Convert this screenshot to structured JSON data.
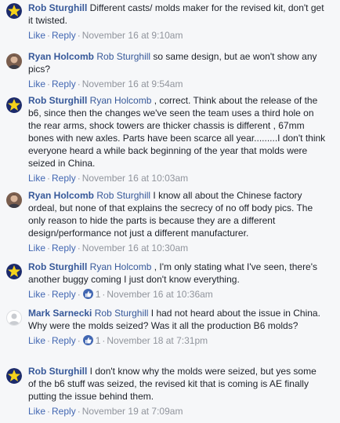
{
  "colors": {
    "background": "#f6f7f9",
    "name_link": "#365899",
    "action_link": "#4267b2",
    "meta_text": "#90949c",
    "body_text": "#1d2129"
  },
  "actions": {
    "like_label": "Like",
    "reply_label": "Reply",
    "separator": "·"
  },
  "comments": [
    {
      "author": "Rob Sturghill",
      "avatar": "yellow-star-avatar",
      "mention": "",
      "text": "Different casts/ molds maker for the revised kit, don't get it twisted.",
      "likes": "",
      "timestamp": "November 16 at 9:10am"
    },
    {
      "author": "Ryan Holcomb",
      "avatar": "profile-photo-avatar",
      "mention": "Rob Sturghill",
      "text": "so same design, but ae won't show any pics?",
      "likes": "",
      "timestamp": "November 16 at 9:54am"
    },
    {
      "author": "Rob Sturghill",
      "avatar": "yellow-star-avatar",
      "mention": "Ryan Holcomb",
      "text": ", correct. Think about the release of the b6, since then the changes we've seen the team uses a third hole on the rear arms, shock towers are thicker chassis is different , 67mm bones with new axles. Parts have been scarce all year.........I don't think everyone heard a while back beginning of the year that molds were seized in China.",
      "likes": "",
      "timestamp": "November 16 at 10:03am"
    },
    {
      "author": "Ryan Holcomb",
      "avatar": "profile-photo-avatar",
      "mention": "Rob Sturghill",
      "text": "I know all about the Chinese factory ordeal, but none of that explains the secrecy of no off body pics. The only reason to hide the parts is because they are a different design/performance not just a different manufacturer.",
      "likes": "",
      "timestamp": "November 16 at 10:30am"
    },
    {
      "author": "Rob Sturghill",
      "avatar": "yellow-star-avatar",
      "mention": "Ryan Holcomb",
      "text": ", I'm only stating what I've seen, there's another buggy coming I just don't know everything.",
      "likes": "1",
      "timestamp": "November 16 at 10:36am"
    },
    {
      "author": "Mark Sarnecki",
      "avatar": "default-silhouette-avatar",
      "mention": "Rob Sturghill",
      "text": "I had not heard about the issue in China. Why were the molds seized? Was it all the production B6 molds?",
      "likes": "1",
      "timestamp": "November 18 at 7:31pm"
    },
    {
      "author": "Rob Sturghill",
      "avatar": "yellow-star-avatar",
      "mention": "",
      "text": "I don't know why the molds were seized, but yes some of the b6 stuff was seized, the revised kit that is coming is AE finally putting the issue behind them.",
      "likes": "",
      "timestamp": "November 19 at 7:09am"
    }
  ]
}
